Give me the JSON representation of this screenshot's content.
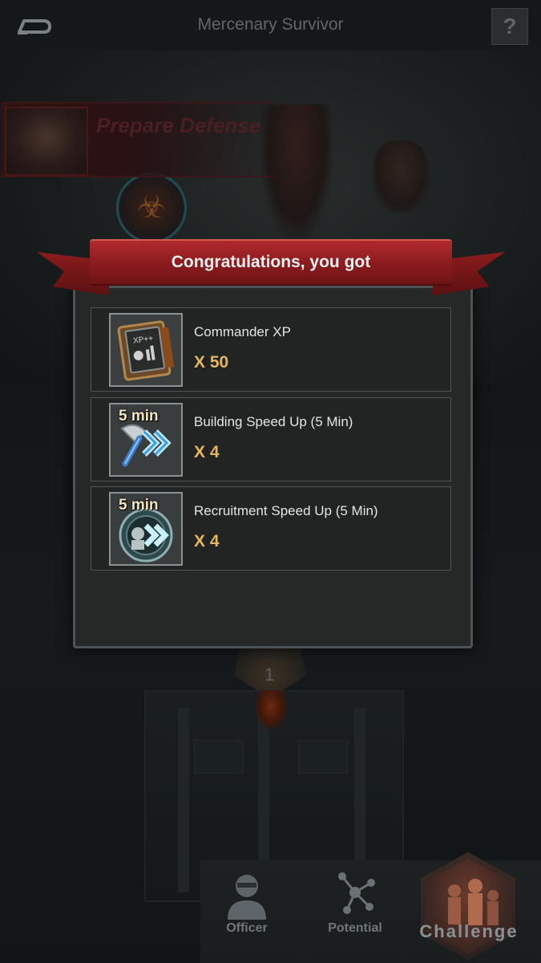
{
  "header": {
    "title": "Mercenary Survivor",
    "back_icon": "back-arrow-icon",
    "help_label": "?"
  },
  "scene": {
    "prepare_banner": "Prepare Defense",
    "stage_number": "1"
  },
  "dialog": {
    "title": "Congratulations, you got",
    "rewards": [
      {
        "name": "Commander XP",
        "quantity": "X 50",
        "icon": "commander-xp-book-icon"
      },
      {
        "name": "Building Speed Up (5 Min)",
        "quantity": "X 4",
        "icon": "building-speedup-icon",
        "tag": "5 min"
      },
      {
        "name": "Recruitment Speed Up (5 Min)",
        "quantity": "X 4",
        "icon": "recruitment-speedup-icon",
        "tag": "5 min"
      }
    ]
  },
  "bottom_nav": {
    "items": [
      {
        "label": "Officer",
        "icon": "officer-portrait-icon"
      },
      {
        "label": "Potential",
        "icon": "potential-network-icon"
      },
      {
        "label": "Challenge",
        "icon": "challenge-zombies-icon"
      }
    ]
  },
  "colors": {
    "ribbon_red": "#8d1c1f",
    "quantity_gold": "#e6b65c",
    "background": "#141718"
  }
}
